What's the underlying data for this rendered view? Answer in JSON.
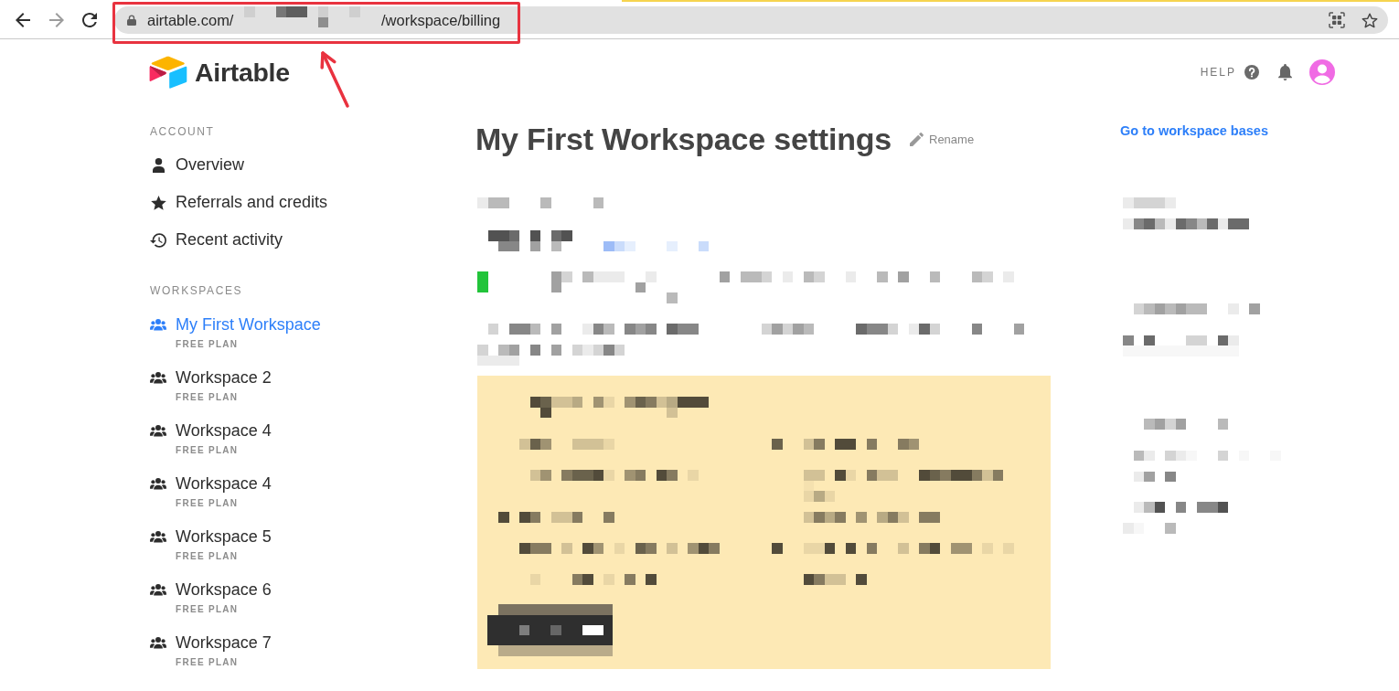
{
  "browser": {
    "nav_buttons": [
      {
        "kind": "back",
        "disabled": false
      },
      {
        "kind": "forward",
        "disabled": true
      },
      {
        "kind": "reload",
        "disabled": false
      }
    ],
    "address_bar": {
      "url_start": "airtable.com/",
      "url_end": "/workspace/billing"
    }
  },
  "header": {
    "logo": "Airtable",
    "help": "HELP"
  },
  "sidebar": {
    "sections": [
      {
        "heading": "ACCOUNT",
        "items": [
          {
            "kind": "person",
            "label": "Overview",
            "selected": false
          },
          {
            "kind": "star",
            "label": "Referrals and credits",
            "selected": false
          },
          {
            "kind": "history",
            "label": "Recent activity",
            "selected": false
          }
        ]
      },
      {
        "heading": "WORKSPACES",
        "items": [
          {
            "kind": "workspace",
            "label": "My First Workspace",
            "plan": "FREE PLAN",
            "selected": true
          },
          {
            "kind": "workspace",
            "label": "Workspace 2",
            "plan": "FREE PLAN",
            "selected": false
          },
          {
            "kind": "workspace",
            "label": "Workspace 4",
            "plan": "FREE PLAN",
            "selected": false
          },
          {
            "kind": "workspace",
            "label": "Workspace 4",
            "plan": "FREE PLAN",
            "selected": false
          },
          {
            "kind": "workspace",
            "label": "Workspace 5",
            "plan": "FREE PLAN",
            "selected": false
          },
          {
            "kind": "workspace",
            "label": "Workspace 6",
            "plan": "FREE PLAN",
            "selected": false
          },
          {
            "kind": "workspace",
            "label": "Workspace 7",
            "plan": "FREE PLAN",
            "selected": false
          }
        ]
      }
    ]
  },
  "main": {
    "title": "My First Workspace settings",
    "rename": "Rename"
  },
  "aside": {
    "link": "Go to workspace bases"
  }
}
